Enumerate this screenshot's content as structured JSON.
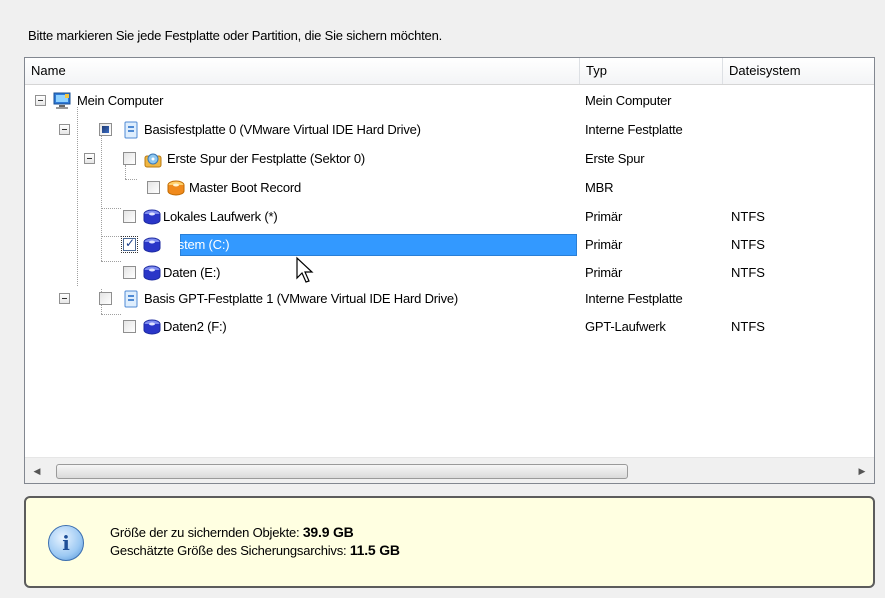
{
  "instruction": "Bitte markieren Sie jede Festplatte oder Partition, die Sie sichern möchten.",
  "columns": {
    "name": "Name",
    "type": "Typ",
    "filesystem": "Dateisystem"
  },
  "rows": [
    {
      "label": "Mein Computer",
      "type": "Mein Computer",
      "fs": "",
      "icon": "computer-icon",
      "check": "none"
    },
    {
      "label": "Basisfestplatte 0 (VMware Virtual IDE Hard Drive)",
      "type": "Interne Festplatte",
      "fs": "",
      "icon": "hard-disk-icon",
      "check": "partial"
    },
    {
      "label": "Erste Spur der Festplatte (Sektor 0)",
      "type": "Erste Spur",
      "fs": "",
      "icon": "first-track-icon",
      "check": "unchecked"
    },
    {
      "label": "Master Boot Record",
      "type": "MBR",
      "fs": "",
      "icon": "mbr-icon",
      "check": "unchecked"
    },
    {
      "label": "Lokales Laufwerk (*)",
      "type": "Primär",
      "fs": "NTFS",
      "icon": "partition-icon",
      "check": "unchecked"
    },
    {
      "label": "System (C:)",
      "type": "Primär",
      "fs": "NTFS",
      "icon": "partition-icon",
      "check": "checked"
    },
    {
      "label": "Daten (E:)",
      "type": "Primär",
      "fs": "NTFS",
      "icon": "partition-icon",
      "check": "unchecked"
    },
    {
      "label": "Basis GPT-Festplatte 1 (VMware Virtual IDE Hard Drive)",
      "type": "Interne Festplatte",
      "fs": "",
      "icon": "hard-disk-icon",
      "check": "unchecked"
    },
    {
      "label": "Daten2 (F:)",
      "type": "GPT-Laufwerk",
      "fs": "NTFS",
      "icon": "partition-icon",
      "check": "unchecked"
    }
  ],
  "selected_row": "System (C:)",
  "info": {
    "size_label": "Größe der zu sichernden Objekte:",
    "size_value": "39.9 GB",
    "archive_label": "Geschätzte Größe des Sicherungsarchivs:",
    "archive_value": "11.5 GB",
    "icon": "info-icon"
  },
  "colors": {
    "selection": "#3399ff",
    "info_background": "#ffffe1"
  }
}
